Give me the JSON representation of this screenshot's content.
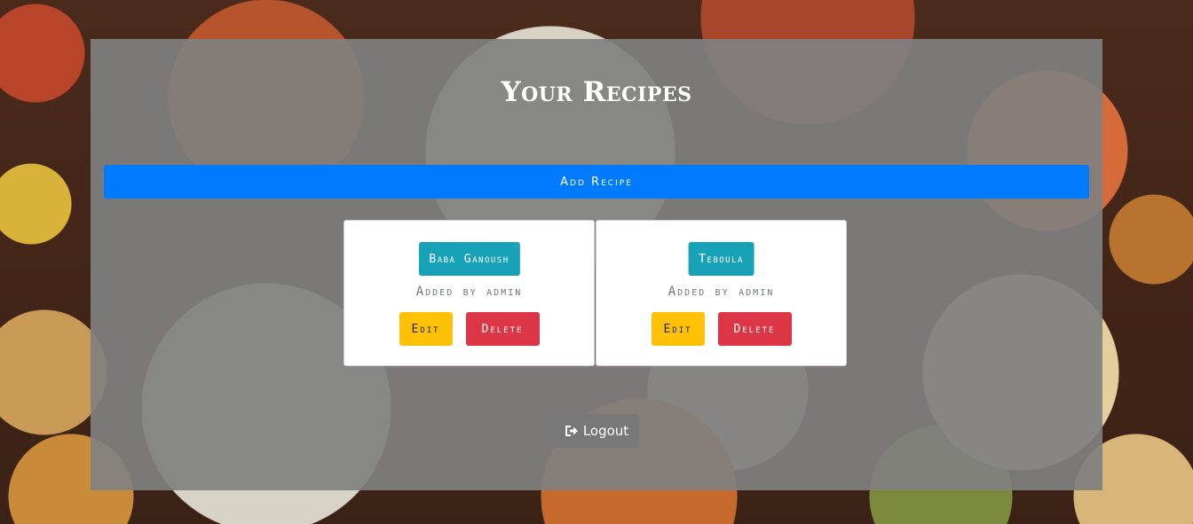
{
  "page": {
    "title": "Your Recipes"
  },
  "actions": {
    "add_recipe_label": "Add Recipe",
    "logout_label": "Logout",
    "logout_icon": "sign-out-icon"
  },
  "recipes": [
    {
      "name": "Baba Ganoush",
      "added_by": "Added by admin",
      "edit_label": "Edit",
      "delete_label": "Delete"
    },
    {
      "name": "Teboula",
      "added_by": "Added by admin",
      "edit_label": "Edit",
      "delete_label": "Delete"
    }
  ],
  "colors": {
    "primary": "#007bff",
    "info": "#17a2b8",
    "warning": "#ffc107",
    "danger": "#dc3545",
    "overlay": "#808080"
  }
}
